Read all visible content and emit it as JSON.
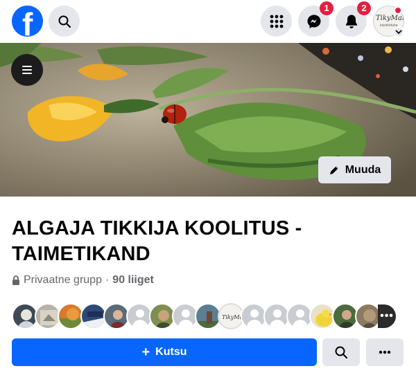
{
  "top_bar": {
    "logo": "facebook-logo",
    "logo_letter": "f",
    "messenger_badge": "1",
    "notifications_badge": "2",
    "profile_logo_text": "TikyMari",
    "profile_logo_sub": "käsitöötuba"
  },
  "cover": {
    "edit_label": "Muuda"
  },
  "group": {
    "title": "ALGAJA TIKKIJA KOOLITUS - TAIMETIKAND",
    "privacy": "Privaatne grupp",
    "separator": "·",
    "members_count": "90 liiget"
  },
  "members": {
    "more_label": "•••"
  },
  "actions": {
    "invite_label": "Kutsu",
    "invite_icon": "+"
  },
  "colors": {
    "brand": "#0866ff",
    "badge": "#e41e3f",
    "button_gray": "#e4e6eb",
    "secondary_text": "#65676b"
  }
}
